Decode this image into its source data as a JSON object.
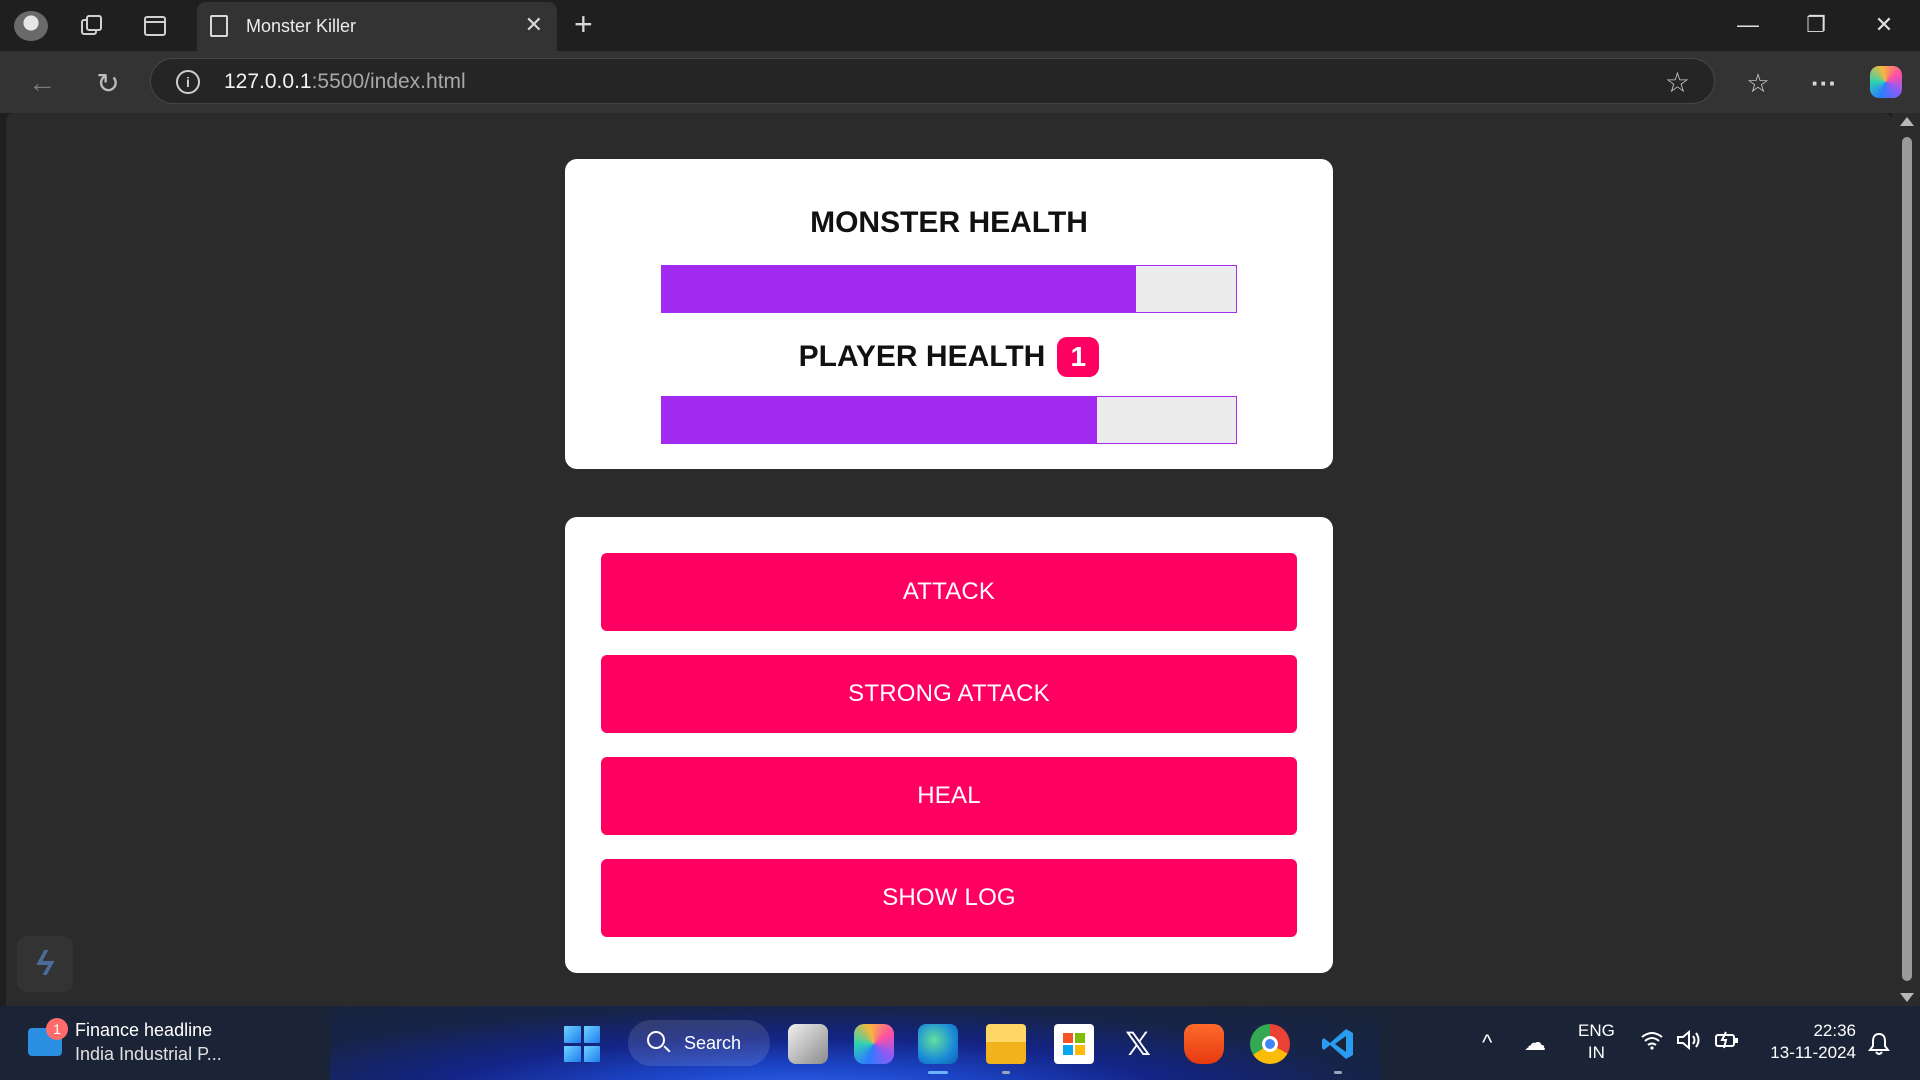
{
  "browser": {
    "tab_title": "Monster Killer",
    "tab_close_glyph": "✕",
    "new_tab_glyph": "+",
    "url_host": "127.0.0.1",
    "url_path": ":5500/index.html",
    "info_glyph": "i",
    "favorite_glyph": "☆",
    "window_controls": {
      "minimize": "—",
      "restore": "❐",
      "close": "✕"
    },
    "toolbar_glyphs": {
      "back": "←",
      "reload": "↻",
      "favorites": "☆",
      "more": "···"
    }
  },
  "game": {
    "monster_health_label": "MONSTER HEALTH",
    "player_health_label": "PLAYER HEALTH",
    "bonus_lives": "1",
    "monster_health_fraction": 0.825,
    "player_health_fraction": 0.757,
    "colors": {
      "accent": "#ff0062",
      "bar_fill": "#a22af0",
      "bar_track": "#ececec"
    },
    "buttons": {
      "attack": "ATTACK",
      "strong_attack": "STRONG ATTACK",
      "heal": "HEAL",
      "show_log": "SHOW LOG"
    }
  },
  "taskbar": {
    "news_badge": "1",
    "news_title": "Finance headline",
    "news_subtitle": "India Industrial P...",
    "search_label": "Search",
    "language_line1": "ENG",
    "language_line2": "IN",
    "time": "22:36",
    "date": "13-11-2024",
    "apps": [
      "task-view-icon",
      "copilot-icon",
      "edge-icon",
      "file-explorer-icon",
      "store-icon",
      "x-icon",
      "brave-icon",
      "chrome-icon",
      "vscode-icon"
    ]
  }
}
